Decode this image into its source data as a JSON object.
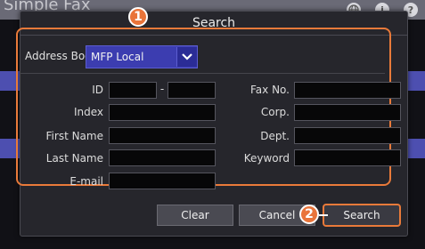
{
  "background": {
    "app_title": "Simple Fax",
    "tool_icons": [
      "globe-icon",
      "info-icon",
      "help-icon"
    ],
    "info_glyph": "i",
    "help_glyph": "?"
  },
  "dialog": {
    "title": "Search",
    "address_book": {
      "label": "Address Book",
      "selected": "MFP Local"
    },
    "fields": {
      "id_label": "ID",
      "id_separator": "-",
      "index_label": "Index",
      "first_name_label": "First Name",
      "last_name_label": "Last Name",
      "email_label": "E-mail",
      "fax_label": "Fax No.",
      "corp_label": "Corp.",
      "dept_label": "Dept.",
      "keyword_label": "Keyword"
    },
    "buttons": {
      "clear": "Clear",
      "cancel": "Cancel",
      "search": "Search"
    }
  },
  "annotations": {
    "marker_1": "1",
    "marker_2": "2",
    "highlight_color": "#e97a3a"
  }
}
